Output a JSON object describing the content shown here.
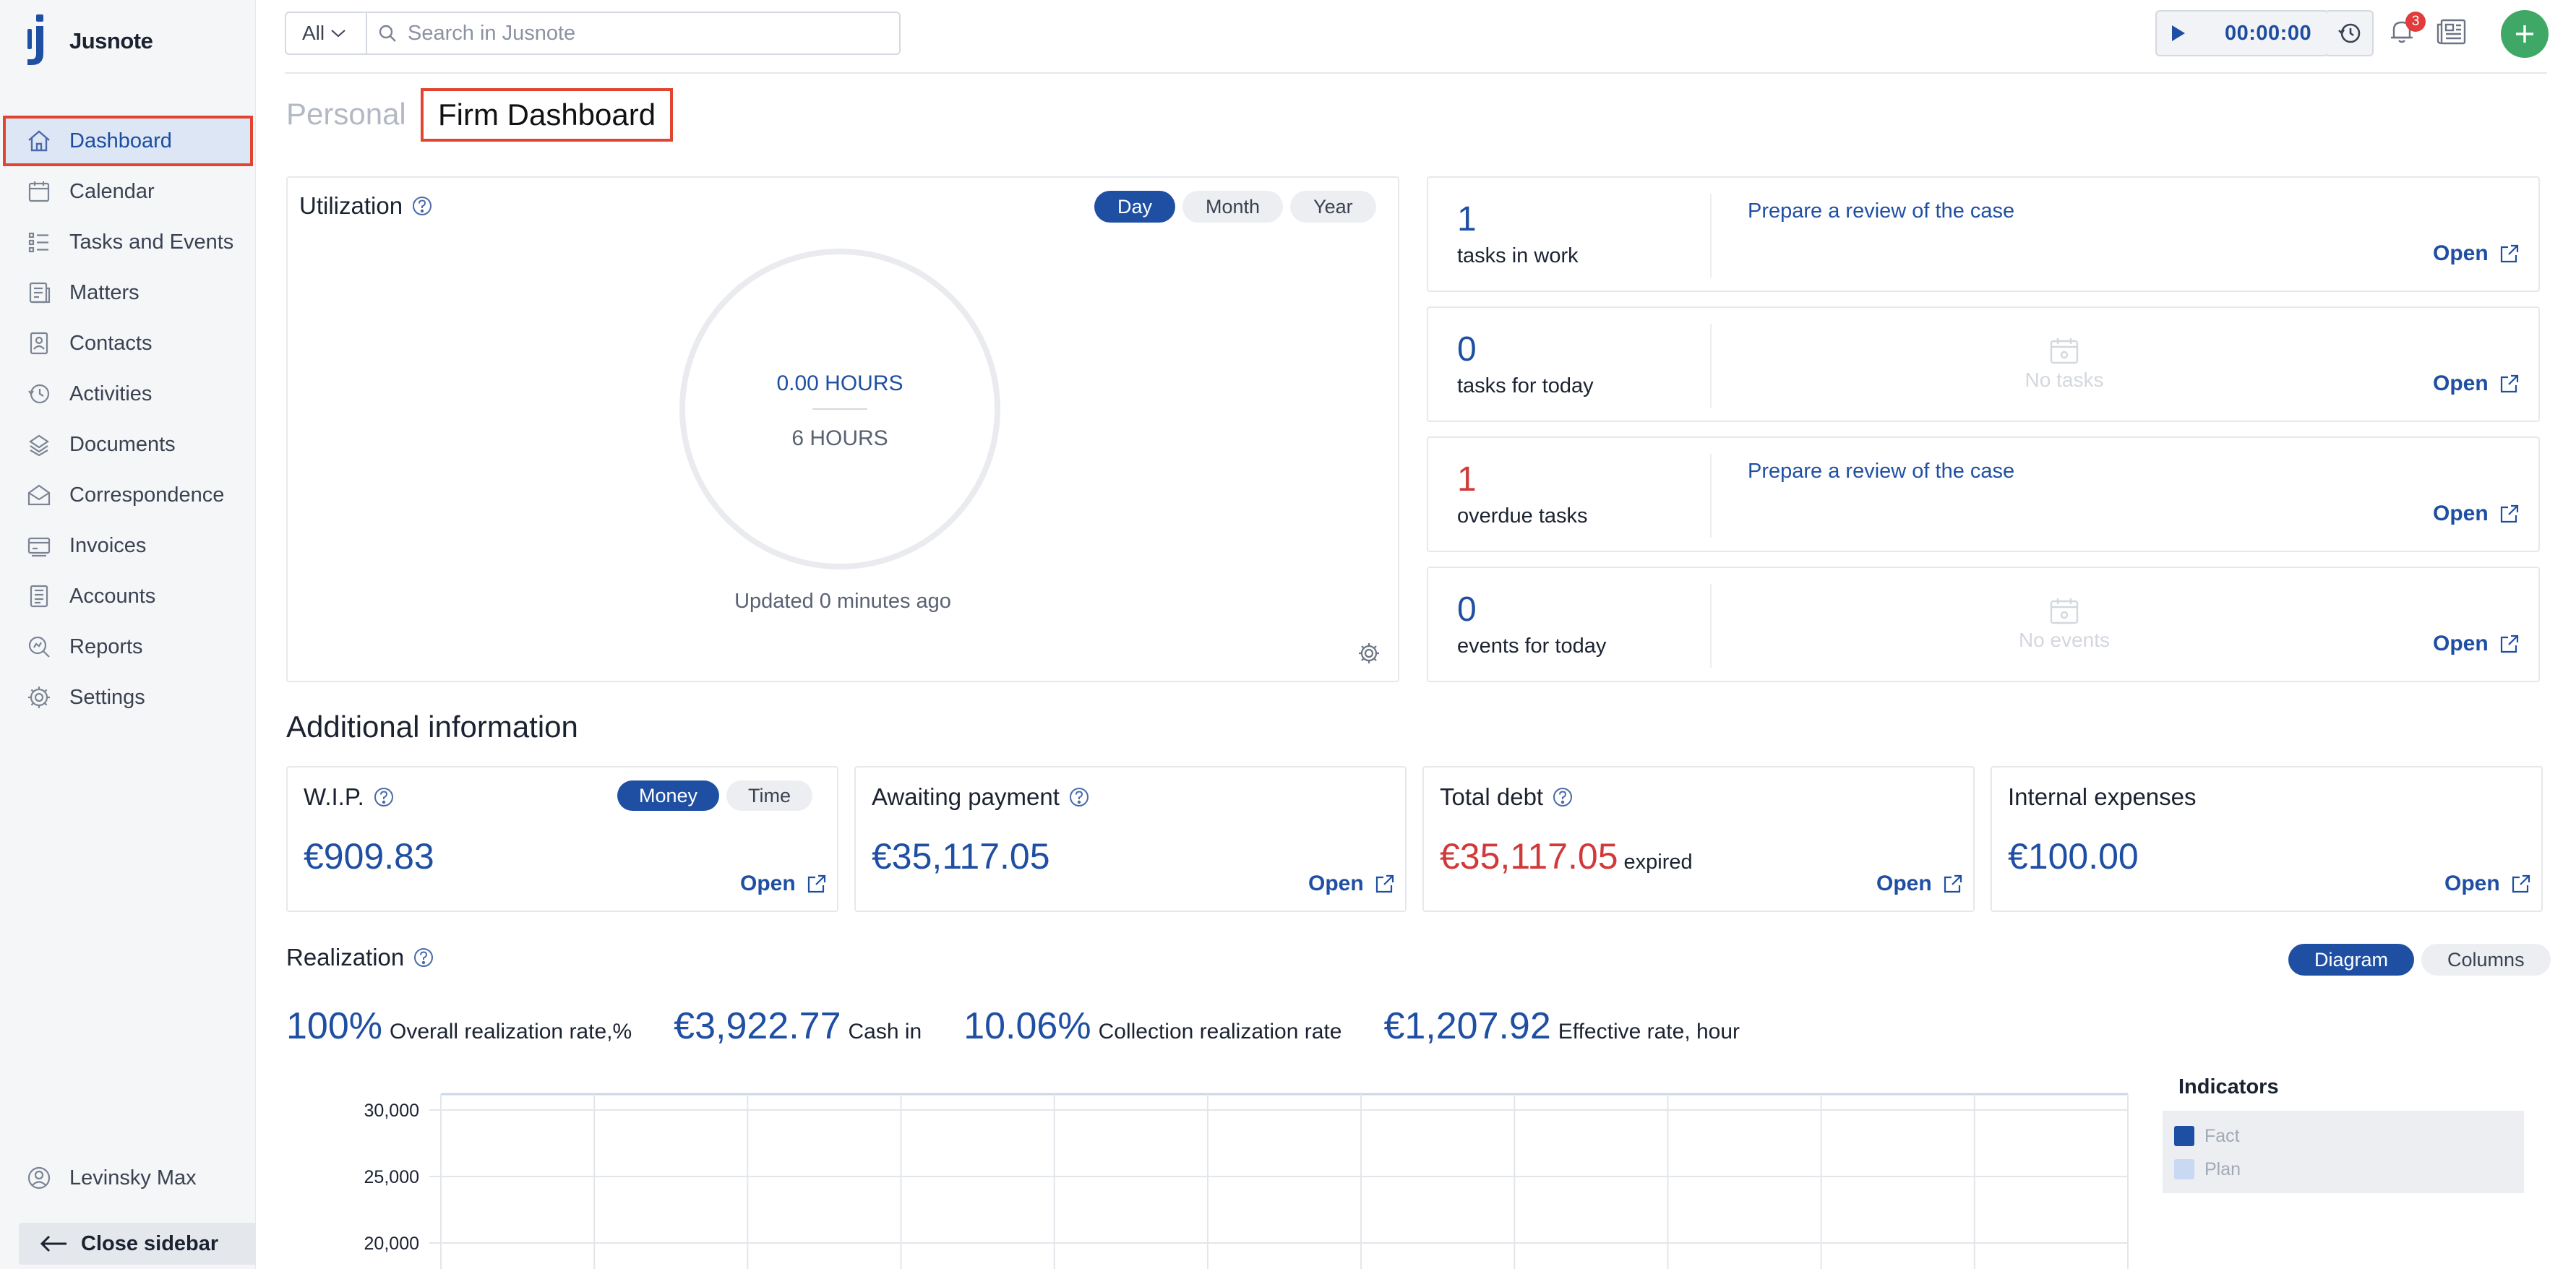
{
  "app": {
    "name": "Jusnote"
  },
  "sidebar": {
    "items": [
      {
        "label": "Dashboard",
        "icon": "home-icon",
        "active": true
      },
      {
        "label": "Calendar",
        "icon": "calendar-icon"
      },
      {
        "label": "Tasks and Events",
        "icon": "tasks-icon"
      },
      {
        "label": "Matters",
        "icon": "matters-icon"
      },
      {
        "label": "Contacts",
        "icon": "contacts-icon"
      },
      {
        "label": "Activities",
        "icon": "activities-icon"
      },
      {
        "label": "Documents",
        "icon": "documents-icon"
      },
      {
        "label": "Correspondence",
        "icon": "correspondence-icon"
      },
      {
        "label": "Invoices",
        "icon": "invoices-icon"
      },
      {
        "label": "Accounts",
        "icon": "accounts-icon"
      },
      {
        "label": "Reports",
        "icon": "reports-icon"
      },
      {
        "label": "Settings",
        "icon": "settings-icon"
      }
    ],
    "user": "Levinsky Max",
    "close_label": "Close sidebar"
  },
  "topbar": {
    "search_scope": "All",
    "search_placeholder": "Search in Jusnote",
    "timer": "00:00:00",
    "notifications_count": "3"
  },
  "tabs": {
    "personal": "Personal",
    "firm": "Firm Dashboard"
  },
  "utilization": {
    "title": "Utilization",
    "periods": [
      "Day",
      "Month",
      "Year"
    ],
    "active_period": "Day",
    "actual": "0.00 HOURS",
    "target": "6 HOURS",
    "updated": "Updated 0 minutes ago"
  },
  "tasks": [
    {
      "count": "1",
      "label": "tasks in work",
      "link": "Prepare a review of the case",
      "empty": ""
    },
    {
      "count": "0",
      "label": "tasks for today",
      "link": "",
      "empty": "No tasks"
    },
    {
      "count": "1",
      "label": "overdue tasks",
      "link": "Prepare a review of the case",
      "empty": ""
    },
    {
      "count": "0",
      "label": "events for today",
      "link": "",
      "empty": "No events"
    }
  ],
  "open_label": "Open",
  "additional": {
    "title": "Additional information",
    "wip": {
      "title": "W.I.P.",
      "toggle": [
        "Money",
        "Time"
      ],
      "value": "€909.83"
    },
    "awaiting": {
      "title": "Awaiting payment",
      "value": "€35,117.05"
    },
    "debt": {
      "title": "Total debt",
      "value": "€35,117.05",
      "suffix": "expired"
    },
    "expenses": {
      "title": "Internal expenses",
      "value": "€100.00"
    }
  },
  "realization": {
    "title": "Realization",
    "views": [
      "Diagram",
      "Columns"
    ],
    "metrics": [
      {
        "value": "100%",
        "label": "Overall realization rate,%"
      },
      {
        "value": "€3,922.77",
        "label": "Cash in"
      },
      {
        "value": "10.06%",
        "label": "Collection realization rate"
      },
      {
        "value": "€1,207.92",
        "label": "Effective rate, hour"
      }
    ]
  },
  "chart_data": {
    "type": "bar",
    "y_ticks": [
      "30,000",
      "25,000",
      "20,000"
    ],
    "ylim_visible": [
      20000,
      30000
    ],
    "legend_title": "Indicators",
    "series": [
      {
        "name": "Fact",
        "color": "#1f4fa3"
      },
      {
        "name": "Plan",
        "color": "#c9d8f3"
      }
    ],
    "grid": true,
    "legend_position": "right"
  },
  "colors": {
    "accent": "#1f4fa3",
    "danger": "#d13a3a",
    "highlight": "#e2452f",
    "add": "#3fa866"
  }
}
